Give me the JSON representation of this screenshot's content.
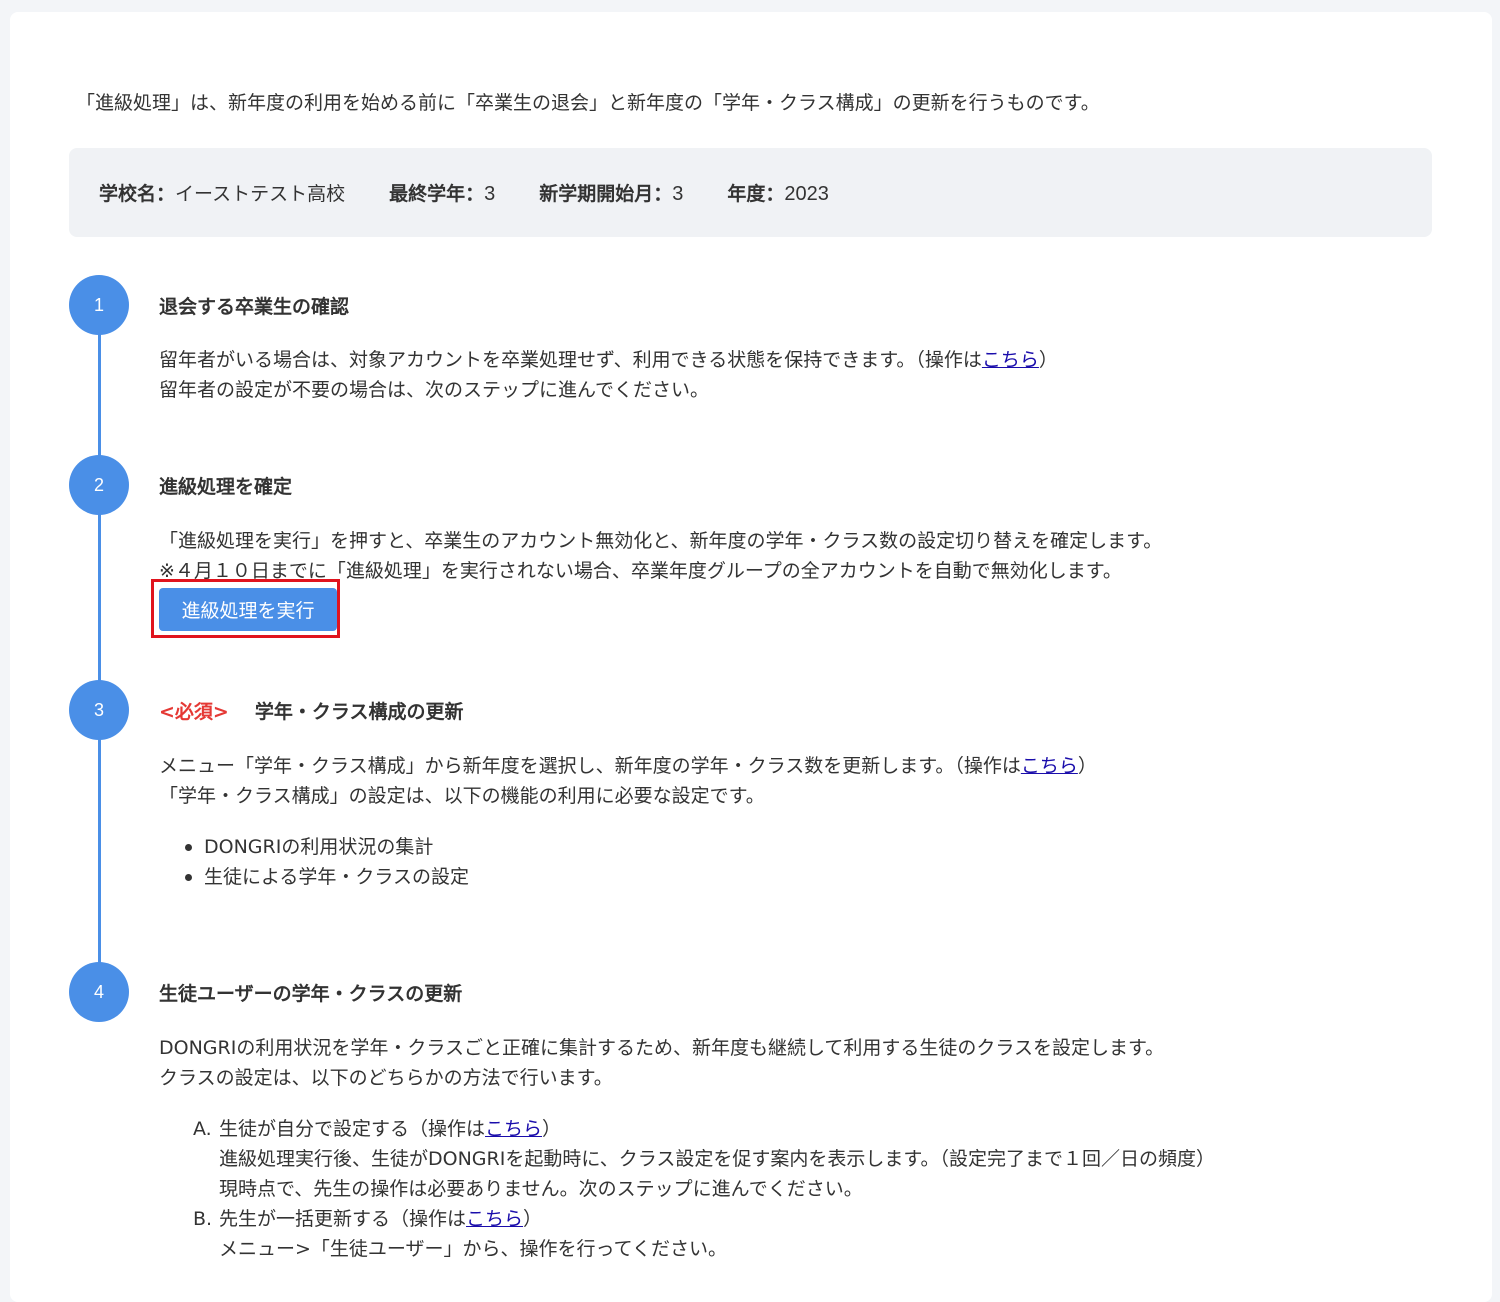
{
  "intro": "「進級処理」は、新年度の利用を始める前に「卒業生の退会」と新年度の「学年・クラス構成」の更新を行うものです。",
  "info": {
    "school_label": "学校名：",
    "school_value": "イーストテスト高校",
    "final_grade_label": "最終学年：",
    "final_grade_value": "3",
    "start_month_label": "新学期開始月：",
    "start_month_value": "3",
    "year_label": "年度：",
    "year_value": "2023"
  },
  "steps": [
    {
      "number": "1",
      "title": "退会する卒業生の確認",
      "line1": "留年者がいる場合は、対象アカウントを卒業処理せず、利用できる状態を保持できます。（操作は",
      "line1_link": "こちら",
      "line1_end": "）",
      "line2": "留年者の設定が不要の場合は、次のステップに進んでください。"
    },
    {
      "number": "2",
      "title": "進級処理を確定",
      "line1": "「進級処理を実行」を押すと、卒業生のアカウント無効化と、新年度の学年・クラス数の設定切り替えを確定します。",
      "line2": "※４月１０日までに「進級処理」を実行されない場合、卒業年度グループの全アカウントを自動で無効化します。",
      "button": "進級処理を実行"
    },
    {
      "number": "3",
      "required": "<必須>",
      "title": "学年・クラス構成の更新",
      "line1": "メニュー「学年・クラス構成」から新年度を選択し、新年度の学年・クラス数を更新します。（操作は",
      "line1_link": "こちら",
      "line1_end": "）",
      "line2": "「学年・クラス構成」の設定は、以下の機能の利用に必要な設定です。",
      "bullets": [
        "DONGRIの利用状況の集計",
        "生徒による学年・クラスの設定"
      ]
    },
    {
      "number": "4",
      "title": "生徒ユーザーの学年・クラスの更新",
      "line1": "DONGRIの利用状況を学年・クラスごと正確に集計するため、新年度も継続して利用する生徒のクラスを設定します。",
      "line2": "クラスの設定は、以下のどちらかの方法で行います。",
      "methods": [
        {
          "letter": "A.",
          "text": "生徒が自分で設定する（操作は",
          "link": "こちら",
          "end": "）",
          "sub": [
            "進級処理実行後、生徒がDONGRIを起動時に、クラス設定を促す案内を表示します。（設定完了まで１回／日の頻度）",
            "現時点で、先生の操作は必要ありません。次のステップに進んでください。"
          ]
        },
        {
          "letter": "B.",
          "text": "先生が一括更新する（操作は",
          "link": "こちら",
          "end": "）",
          "sub": [
            "メニュー>「生徒ユーザー」から、操作を行ってください。"
          ]
        }
      ]
    }
  ],
  "colors": {
    "accent": "#4a8fe7",
    "required": "#e53935",
    "highlight_border": "#e0141e",
    "link": "#1a0dab"
  }
}
